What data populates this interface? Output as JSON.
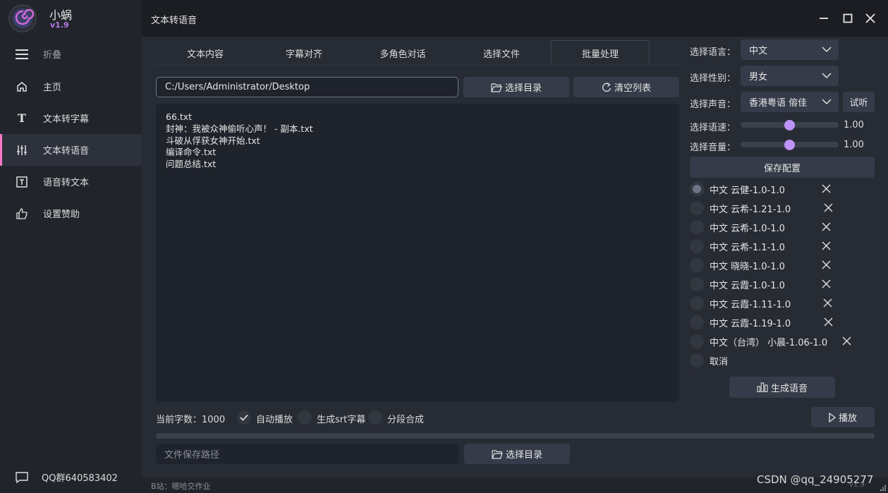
{
  "app": {
    "name": "小蜗",
    "version": "v1.9",
    "window_title": "文本转语音"
  },
  "sidebar": {
    "toggle_label": "折叠",
    "items": [
      {
        "label": "主页",
        "icon": "home-icon"
      },
      {
        "label": "文本转字幕",
        "icon": "text-t-icon"
      },
      {
        "label": "文本转语音",
        "icon": "sliders-icon"
      },
      {
        "label": "语音转文本",
        "icon": "text-box-icon"
      },
      {
        "label": "设置赞助",
        "icon": "thumbs-up-icon"
      }
    ],
    "footer_label": "QQ群640583402"
  },
  "tabs": [
    "文本内容",
    "字幕对齐",
    "多角色对话",
    "选择文件",
    "批量处理"
  ],
  "active_tab": "批量处理",
  "batch": {
    "dir_value": "C:/Users/Administrator/Desktop",
    "choose_dir_label": "选择目录",
    "clear_list_label": "清空列表",
    "files": [
      "66.txt",
      "封神：我被众神偷听心声！ - 副本.txt",
      "斗破从俘获女神开始.txt",
      "编译命令.txt",
      "问题总结.txt"
    ]
  },
  "options": {
    "char_count": "当前字数：1000",
    "auto_play": "自动播放",
    "gen_srt": "生成srt字幕",
    "segment": "分段合成"
  },
  "save": {
    "placeholder": "文件保存路径",
    "choose_dir_label": "选择目录"
  },
  "right": {
    "language_label": "选择语言：",
    "language_value": "中文",
    "gender_label": "选择性别：",
    "gender_value": "男女",
    "voice_label": "选择声音：",
    "voice_value": "香港粤语 傛佳",
    "listen_label": "试听",
    "speed_label": "选择语速：",
    "speed_value": "1.00",
    "volume_label": "选择音量：",
    "volume_value": "1.00",
    "save_config_label": "保存配置",
    "presets": [
      "中文 云健-1.0-1.0",
      "中文 云希-1.21-1.0",
      "中文 云希-1.0-1.0",
      "中文 云希-1.1-1.0",
      "中文 晓晓-1.0-1.0",
      "中文 云霞-1.0-1.0",
      "中文 云霞-1.11-1.0",
      "中文 云霞-1.19-1.0",
      "中文（台湾） 小晨-1.06-1.0"
    ],
    "cancel_label": "取消",
    "generate_label": "生成语音",
    "play_label": "播放"
  },
  "status": {
    "left_text": "B站：嗯哈交作业",
    "watermark": "CSDN @qq_24905277",
    "version_right": "v1.9"
  },
  "colors": {
    "accent": "#bd93f9",
    "active_bar": "#ff79c6",
    "version": "#b77be6"
  }
}
